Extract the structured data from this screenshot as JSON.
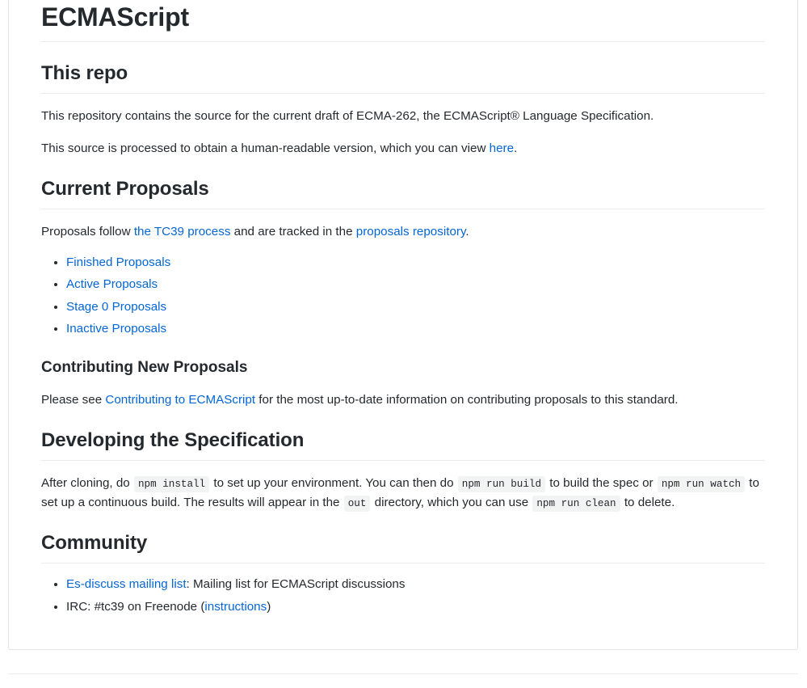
{
  "document": {
    "title": "ECMAScript",
    "sections": [
      {
        "heading": "This repo",
        "paragraphs": [
          {
            "parts": [
              {
                "type": "text",
                "value": "This repository contains the source for the current draft of ECMA-262, the ECMAScript® Language Specification."
              }
            ]
          },
          {
            "parts": [
              {
                "type": "text",
                "value": "This source is processed to obtain a human-readable version, which you can view "
              },
              {
                "type": "link",
                "value": "here"
              },
              {
                "type": "text",
                "value": "."
              }
            ]
          }
        ]
      },
      {
        "heading": "Current Proposals",
        "intro": {
          "lead": "Proposals follow ",
          "link1": "the TC39 process",
          "middle": " and are tracked in the ",
          "link2": "proposals repository",
          "tail": "."
        },
        "items": [
          "Finished Proposals",
          "Active Proposals",
          "Stage 0 Proposals",
          "Inactive Proposals"
        ],
        "subsection": {
          "heading": "Contributing New Proposals",
          "lead": "Please see ",
          "link": "Contributing to ECMAScript",
          "tail": " for the most up-to-date information on contributing proposals to this standard."
        }
      },
      {
        "heading": "Developing the Specification",
        "body": {
          "p1": "After cloning, do ",
          "code1": "npm install",
          "p2": " to set up your environment. You can then do ",
          "code2": "npm run build",
          "p3": " to build the spec or ",
          "code3": "npm run watch",
          "p4": " to set up a continuous build. The results will appear in the ",
          "code4": "out",
          "p5": " directory, which you can use ",
          "code5": "npm run clean",
          "p6": " to delete."
        }
      },
      {
        "heading": "Community",
        "items": [
          {
            "link": "Es-discuss mailing list",
            "text": ": Mailing list for ECMAScript discussions"
          },
          {
            "prefix": "IRC: #tc39 on Freenode (",
            "link": "instructions",
            "suffix": ")"
          }
        ]
      }
    ]
  },
  "colors": {
    "link": "#0366d6",
    "text": "#24292e",
    "rule": "#eaecef",
    "border": "#e1e4e8",
    "code_background": "rgba(27,31,35,0.055)"
  }
}
